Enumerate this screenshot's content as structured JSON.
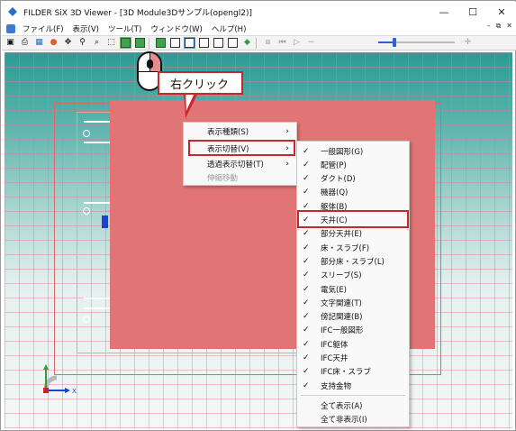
{
  "window": {
    "title": "FILDER SiX 3D Viewer - [3D Module3Dサンプル(opengl2)]",
    "minimize": "—",
    "maximize": "☐",
    "close": "✕"
  },
  "menubar": {
    "items": [
      "ファイル(F)",
      "表示(V)",
      "ツール(T)",
      "ウィンドウ(W)",
      "ヘルプ(H)"
    ],
    "mdi_buttons": [
      "–",
      "⧉",
      "✕"
    ]
  },
  "toolbar": {
    "icons": [
      "camera-icon",
      "print-icon",
      "table-icon",
      "paint-icon",
      "move-icon",
      "zoom-icon",
      "zoom-window-icon",
      "select-icon",
      "cube-green-icon",
      "cube-green-icon",
      "cube-white-icon",
      "cube-white-icon",
      "cube-wire-icon",
      "cube-wire-icon",
      "cube-wire-icon",
      "cube-wire-icon",
      "gem-green-icon"
    ],
    "slider_value": 0.2,
    "accent": "#2a63d2"
  },
  "callout": {
    "label": "右クリック"
  },
  "context_menu": {
    "items": [
      {
        "label": "表示種類(S)",
        "submenu": true,
        "disabled": false
      },
      {
        "label": "表示切替(V)",
        "submenu": true,
        "disabled": false,
        "highlighted": true
      },
      {
        "label": "透過表示切替(T)",
        "submenu": true,
        "disabled": false
      },
      {
        "label": "伸縮移動",
        "submenu": false,
        "disabled": true
      }
    ]
  },
  "submenu": {
    "items": [
      {
        "label": "一般図形(G)",
        "checked": true
      },
      {
        "label": "配管(P)",
        "checked": true
      },
      {
        "label": "ダクト(D)",
        "checked": true
      },
      {
        "label": "機器(Q)",
        "checked": true
      },
      {
        "label": "躯体(B)",
        "checked": true
      },
      {
        "label": "天井(C)",
        "checked": true,
        "highlighted": true
      },
      {
        "label": "部分天井(E)",
        "checked": true
      },
      {
        "label": "床・スラブ(F)",
        "checked": true
      },
      {
        "label": "部分床・スラブ(L)",
        "checked": true
      },
      {
        "label": "スリーブ(S)",
        "checked": true
      },
      {
        "label": "電気(E)",
        "checked": true
      },
      {
        "label": "文字関連(T)",
        "checked": true
      },
      {
        "label": "傍記関連(B)",
        "checked": true
      },
      {
        "label": "IFC一般図形",
        "checked": true
      },
      {
        "label": "IFC躯体",
        "checked": true
      },
      {
        "label": "IFC天井",
        "checked": true
      },
      {
        "label": "IFC床・スラブ",
        "checked": true
      },
      {
        "label": "支持金物",
        "checked": true
      }
    ],
    "footer": [
      {
        "label": "全て表示(A)"
      },
      {
        "label": "全て非表示(I)"
      }
    ],
    "check_glyph": "✓"
  },
  "axes": {
    "x_label": "X",
    "colors": {
      "x": "#1d3fd3",
      "y": "#2e9d3a",
      "z": "#d32020"
    }
  },
  "colors": {
    "highlight": "#c62828",
    "pink_object": "#e17575"
  }
}
